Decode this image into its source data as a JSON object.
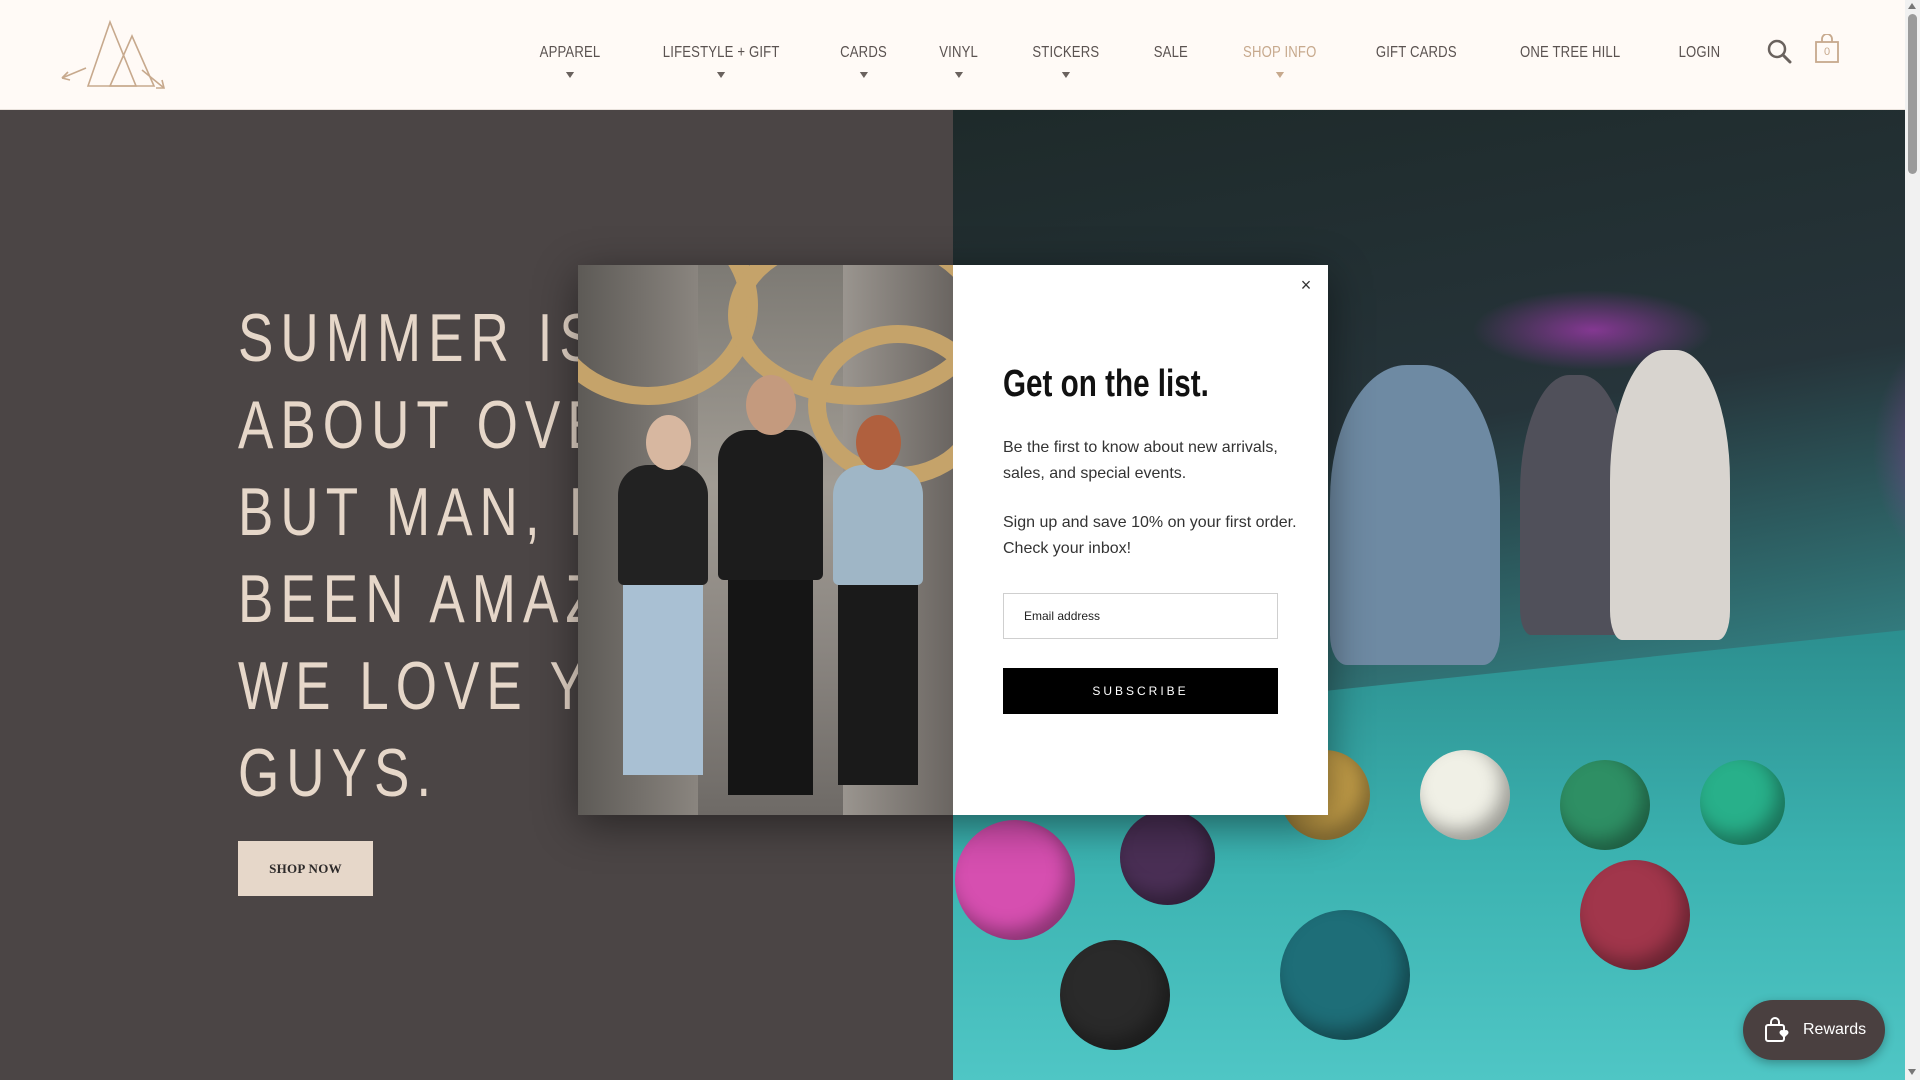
{
  "header": {
    "nav": [
      {
        "label": "APPAREL",
        "dropdown": true,
        "active": false
      },
      {
        "label": "LIFESTYLE + GIFT",
        "dropdown": true,
        "active": false
      },
      {
        "label": "CARDS",
        "dropdown": true,
        "active": false
      },
      {
        "label": "VINYL",
        "dropdown": true,
        "active": false
      },
      {
        "label": "STICKERS",
        "dropdown": true,
        "active": false
      },
      {
        "label": "SALE",
        "dropdown": false,
        "active": false
      },
      {
        "label": "SHOP INFO",
        "dropdown": true,
        "active": true
      },
      {
        "label": "GIFT CARDS",
        "dropdown": false,
        "active": false
      },
      {
        "label": "ONE TREE HILL",
        "dropdown": false,
        "active": false
      },
      {
        "label": "LOGIN",
        "dropdown": false,
        "active": false
      }
    ],
    "cart_count": "0",
    "icons": {
      "search": "search-icon",
      "cart": "shopping-bag-icon",
      "logo": "triangle-arrows-logo"
    }
  },
  "hero": {
    "lines": [
      "SUMMER IS J",
      "ABOUT OVER",
      "BUT MAN, IT",
      "BEEN AMAZIN",
      "WE LOVE YOU",
      "GUYS."
    ],
    "button_label": "SHOP NOW"
  },
  "popup": {
    "title": "Get on the list.",
    "text1": "Be the first to know about new arrivals, sales, and special events.",
    "text2": "Sign up and save 10% on your first order.  Check your inbox!",
    "email_placeholder": "Email address",
    "email_value": "",
    "subscribe_label": "SUBSCRIBE",
    "close_glyph": "×"
  },
  "rewards": {
    "label": "Rewards"
  },
  "colors": {
    "accent": "#c7a98d",
    "hero_bg": "#4b4545",
    "hero_text": "#e6d7c9",
    "header_bg": "#fffaf6"
  }
}
